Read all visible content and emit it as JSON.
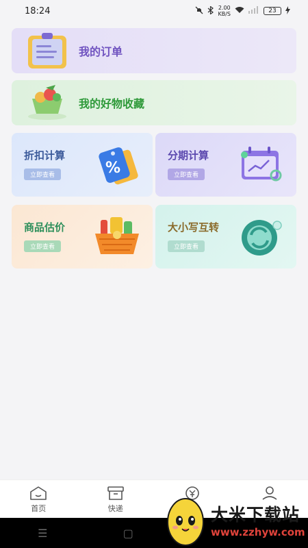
{
  "status_bar": {
    "time": "18:24",
    "net_speed": "2.00",
    "net_unit": "KB/S",
    "battery": "23",
    "icons": [
      "mute-icon",
      "bluetooth-icon",
      "wifi-icon",
      "signal-icon",
      "battery-icon",
      "charging-icon"
    ]
  },
  "menu": {
    "orders_label": "我的订单",
    "favorites_label": "我的好物收藏"
  },
  "tools": [
    {
      "title": "折扣计算",
      "action": "立即查看"
    },
    {
      "title": "分期计算",
      "action": "立即查看"
    },
    {
      "title": "商品估价",
      "action": "立即查看"
    },
    {
      "title": "大小写互转",
      "action": "立即查看"
    }
  ],
  "tab_bar": {
    "home": "首页",
    "express": "快递"
  },
  "watermark": {
    "brand": "大米下载站",
    "url": "www.zzhyw.com"
  },
  "colors": {
    "orders_text": "#7053c0",
    "favorites_text": "#2f9a3a",
    "background": "#f4f4f6"
  }
}
